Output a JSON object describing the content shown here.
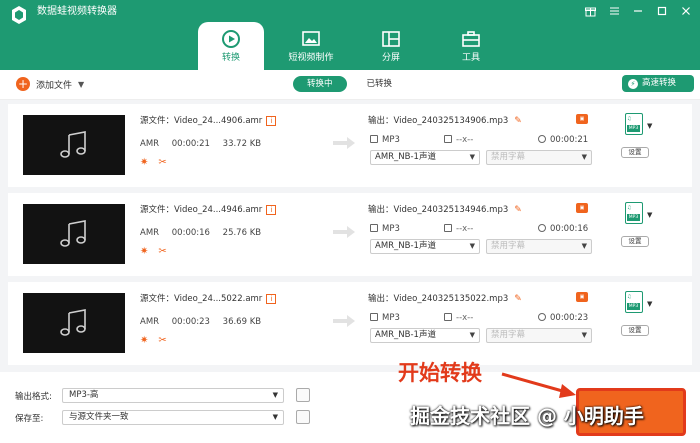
{
  "app": {
    "title": "数据蛙视频转换器"
  },
  "colors": {
    "brand": "#1e9a72",
    "accent": "#f0641e",
    "annotation": "#e23a1b"
  },
  "window_controls": [
    "gift-icon",
    "menu-icon",
    "minimize-icon",
    "maximize-icon",
    "close-icon"
  ],
  "tabs": [
    {
      "label": "转换",
      "icon": "convert-icon",
      "active": true
    },
    {
      "label": "短视频制作",
      "icon": "short-video-icon",
      "active": false
    },
    {
      "label": "分屏",
      "icon": "split-screen-icon",
      "active": false
    },
    {
      "label": "工具",
      "icon": "toolbox-icon",
      "active": false
    }
  ],
  "toolbar": {
    "add_file": "添加文件",
    "segments": [
      "转换中",
      "已转换"
    ],
    "fast_convert": "高速转换"
  },
  "files": [
    {
      "source_name": "源文件：Video_24...4906.amr",
      "format": "AMR",
      "duration": "00:00:21",
      "size": "33.72 KB",
      "output_name": "输出：Video_240325134906.mp3",
      "out_format": "MP3",
      "out_resolution": "--x--",
      "out_duration": "00:00:21",
      "audio_track": "AMR_NB-1声道",
      "subtitle": "禁用字幕",
      "fmt_label": "MP3",
      "settings": "设置"
    },
    {
      "source_name": "源文件：Video_24...4946.amr",
      "format": "AMR",
      "duration": "00:00:16",
      "size": "25.76 KB",
      "output_name": "输出：Video_240325134946.mp3",
      "out_format": "MP3",
      "out_resolution": "--x--",
      "out_duration": "00:00:16",
      "audio_track": "AMR_NB-1声道",
      "subtitle": "禁用字幕",
      "fmt_label": "MP3",
      "settings": "设置"
    },
    {
      "source_name": "源文件：Video_24...5022.amr",
      "format": "AMR",
      "duration": "00:00:23",
      "size": "36.69 KB",
      "output_name": "输出：Video_240325135022.mp3",
      "out_format": "MP3",
      "out_resolution": "--x--",
      "out_duration": "00:00:23",
      "audio_track": "AMR_NB-1声道",
      "subtitle": "禁用字幕",
      "fmt_label": "MP3",
      "settings": "设置"
    }
  ],
  "footer": {
    "output_format_label": "输出格式:",
    "output_format_value": "MP3-高",
    "save_to_label": "保存至:",
    "save_to_value": "与源文件夹一致"
  },
  "overlays": {
    "annotation": "开始转换",
    "watermark": "掘金技术社区 @ 小明助手"
  }
}
